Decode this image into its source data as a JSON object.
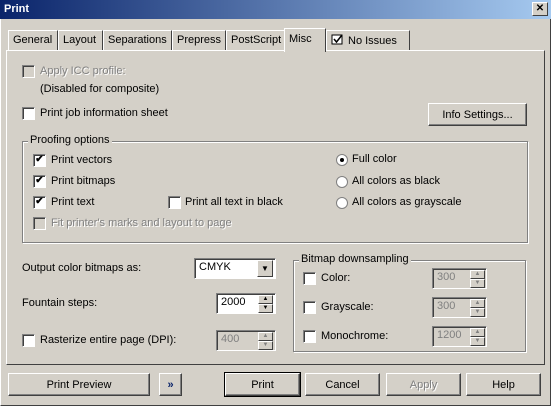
{
  "window": {
    "title": "Print",
    "close_glyph": "✕"
  },
  "tabs": [
    {
      "label": "General"
    },
    {
      "label": "Layout"
    },
    {
      "label": "Separations"
    },
    {
      "label": "Prepress"
    },
    {
      "label": "PostScript"
    },
    {
      "label": "Misc"
    },
    {
      "label": "No Issues",
      "icon": "issues-icon"
    }
  ],
  "active_tab": "Misc",
  "misc": {
    "apply_icc": {
      "label": "Apply ICC profile:",
      "checked": false,
      "disabled": true
    },
    "composite_note": "(Disabled for composite)",
    "print_job_info": {
      "label": "Print job information sheet",
      "checked": false
    },
    "info_settings_button": "Info Settings...",
    "proofing": {
      "title": "Proofing options",
      "print_vectors": {
        "label": "Print vectors",
        "checked": true
      },
      "print_bitmaps": {
        "label": "Print bitmaps",
        "checked": true
      },
      "print_text": {
        "label": "Print text",
        "checked": true
      },
      "print_all_text_black": {
        "label": "Print all text in black",
        "checked": false
      },
      "fit_marks": {
        "label": "Fit printer's marks and layout to page",
        "checked": false,
        "disabled": true
      },
      "color_modes": [
        {
          "label": "Full color",
          "selected": true
        },
        {
          "label": "All colors as black",
          "selected": false
        },
        {
          "label": "All colors as grayscale",
          "selected": false
        }
      ]
    },
    "output_color_bitmaps": {
      "label": "Output color bitmaps as:",
      "value": "CMYK",
      "arrow": "▼"
    },
    "fountain_steps": {
      "label": "Fountain steps:",
      "value": "2000"
    },
    "rasterize": {
      "label": "Rasterize entire page (DPI):",
      "checked": false,
      "value": "400"
    },
    "bitmap_downsampling": {
      "title": "Bitmap downsampling",
      "color": {
        "label": "Color:",
        "checked": false,
        "value": "300"
      },
      "grayscale": {
        "label": "Grayscale:",
        "checked": false,
        "value": "300"
      },
      "monochrome": {
        "label": "Monochrome:",
        "checked": false,
        "value": "1200"
      }
    }
  },
  "footer": {
    "print_preview": "Print Preview",
    "expand_glyph": "»",
    "print": "Print",
    "cancel": "Cancel",
    "apply": "Apply",
    "help": "Help"
  },
  "glyphs": {
    "check": "✔",
    "up": "▲",
    "down": "▼"
  }
}
